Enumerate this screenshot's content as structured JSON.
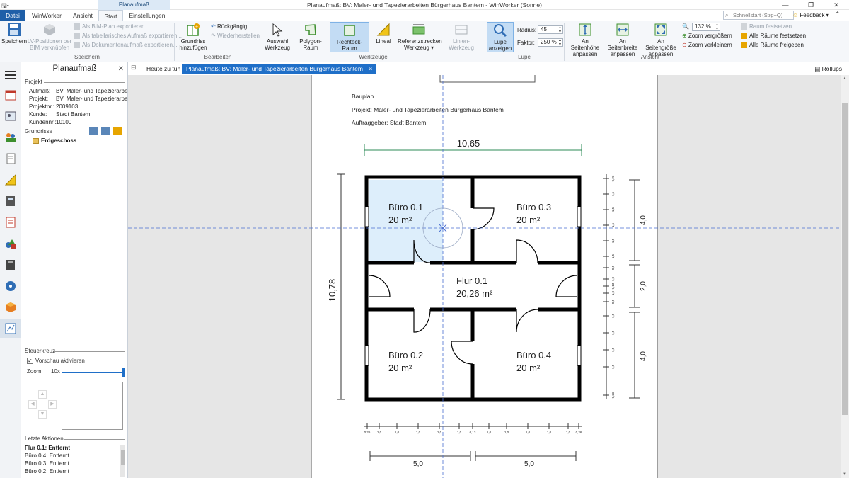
{
  "window": {
    "title": "Planaufmaß: BV: Maler- und Tapezierarbeiten Bürgerhaus Bantem - WinWorker (Sonne)",
    "context_tab": "Planaufmaß"
  },
  "menu": {
    "tabs": [
      "Datei",
      "WinWorker",
      "Ansicht",
      "Start",
      "Einstellungen"
    ],
    "active": "Start",
    "search_placeholder": "Schnellstart (Strg+Q)",
    "feedback": "Feedback"
  },
  "ribbon": {
    "groups": [
      "Speichern",
      "Bearbeiten",
      "Werkzeuge",
      "Lupe",
      "Ansicht"
    ],
    "save": "Speichern",
    "lv_link": "LV-Positionen per BIM verknüpfen",
    "exp_bim": "Als BIM-Plan exportieren...",
    "exp_table": "Als tabellarisches Aufmaß exportieren...",
    "exp_doc": "Als Dokumentenaufmaß exportieren...",
    "add_plan": "Grundriss hinzufügen",
    "undo": "Rückgängig",
    "redo": "Wiederherstellen",
    "select_tool": "Auswahl Werkzeug",
    "polygon": "Polygon-Raum",
    "rect": "Rechteck-Raum",
    "ruler": "Lineal",
    "ref": "Referenzstrecken Werkzeug",
    "line_tool": "Linien-Werkzeug",
    "loupe": "Lupe anzeigen",
    "radius_label": "Radius:",
    "radius_value": "45",
    "factor_label": "Faktor:",
    "factor_value": "250 %",
    "fit_height": "An Seitenhöhe anpassen",
    "fit_width": "An Seitenbreite anpassen",
    "fit_page": "An Seitengröße anpassen",
    "zoom_value": "132 %",
    "zoom_in": "Zoom vergrößern",
    "zoom_out": "Zoom verkleinern",
    "room_fix": "Raum festsetzen",
    "all_fix": "Alle Räume festsetzen",
    "all_release": "Alle Räume freigeben"
  },
  "panel": {
    "title": "Planaufmaß",
    "project_section": "Projekt",
    "fields": [
      {
        "key": "Aufmaß:",
        "value": "BV: Maler- und Tapezierarbe..."
      },
      {
        "key": "Projekt:",
        "value": "BV: Maler- und Tapezierarbe..."
      },
      {
        "key": "Projektnr.:",
        "value": "2009103"
      },
      {
        "key": "Kunde:",
        "value": "Stadt Bantem"
      },
      {
        "key": "Kundennr.:",
        "value": "10100"
      }
    ],
    "plans_section": "Grundrisse",
    "plan_item": "Erdgeschoss",
    "steer_section": "Steuerkreuz",
    "preview_label": "Vorschau aktivieren",
    "zoom_label": "Zoom:",
    "zoom_value": "10x",
    "actions_section": "Letzte Aktionen",
    "actions": [
      "Flur 0.1: Entfernt",
      "Büro 0.4: Entfernt",
      "Büro 0.3: Entfernt",
      "Büro 0.2: Entfernt"
    ]
  },
  "tabs": [
    "Heute zu tun",
    "Planaufmaß: BV: Maler- und Tapezierarbeiten Bürgerhaus Bantem"
  ],
  "tab_close": "×",
  "rollups": "Rollups",
  "plan": {
    "header": [
      "Bauplan",
      "Projekt: Maler- und Tapezierarbeiten Bürgerhaus Bantem",
      "Auftraggeber: Stadt Bantem"
    ],
    "total_width": "10,65",
    "total_height": "10,78",
    "rooms": [
      {
        "name": "Büro 0.1",
        "area": "20 m²"
      },
      {
        "name": "Büro 0.3",
        "area": "20 m²"
      },
      {
        "name": "Flur 0.1",
        "area": "20,26 m²"
      },
      {
        "name": "Büro 0.2",
        "area": "20 m²"
      },
      {
        "name": "Büro 0.4",
        "area": "20 m²"
      }
    ],
    "right_dims": [
      "4,0",
      "2,0",
      "4,0"
    ],
    "bottom_dims": [
      "5,0",
      "5,0"
    ],
    "bottom_ticks": [
      "0,26",
      "1,0",
      "1,0",
      "1,0",
      "1,0",
      "1,0",
      "0,13",
      "1,0",
      "1,0",
      "1,0",
      "1,0",
      "1,0",
      "0,26"
    ],
    "side_ticks": [
      "0,26",
      "1,5",
      "1,5",
      "1,5",
      "1,5",
      "1,5",
      "0,5",
      "1,0",
      "0,13",
      "1,0",
      "0,5",
      "1,5",
      "1,5",
      "1,5",
      "1,5",
      "0,26"
    ]
  }
}
